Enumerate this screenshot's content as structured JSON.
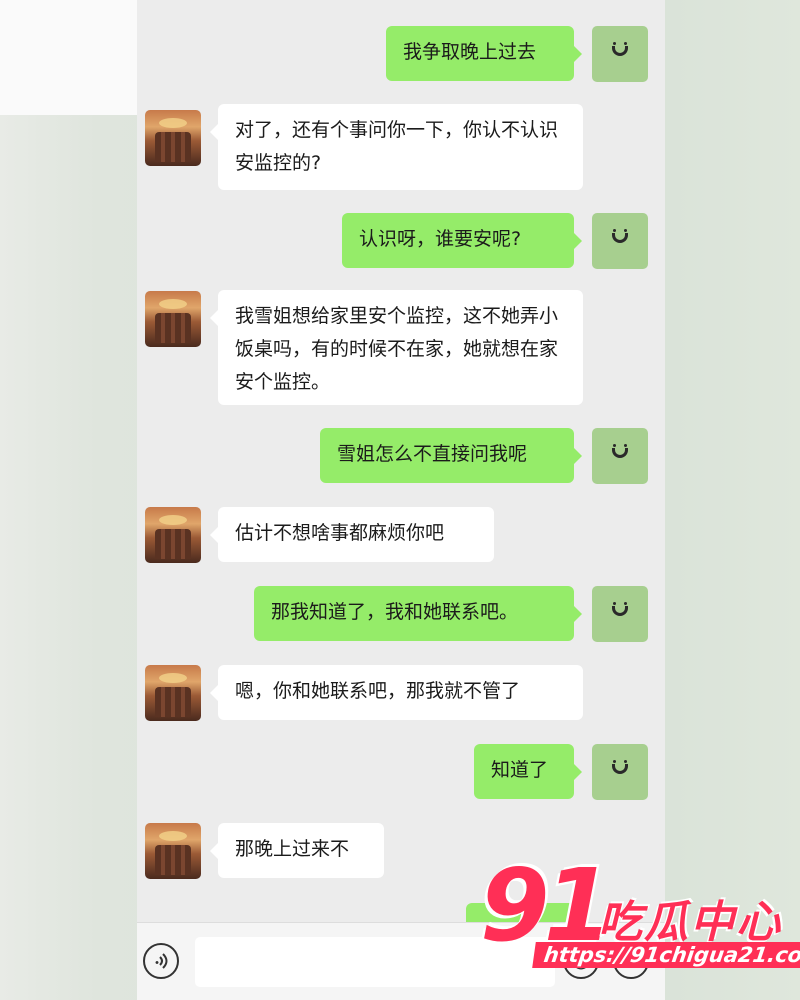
{
  "messages": [
    {
      "side": "out",
      "text": "我争取晚上过去"
    },
    {
      "side": "in",
      "text": "对了，还有个事问你一下，你认不认识安监控的?"
    },
    {
      "side": "out",
      "text": "认识呀，谁要安呢?"
    },
    {
      "side": "in",
      "text": "我雪姐想给家里安个监控，这不她弄小饭桌吗，有的时候不在家，她就想在家安个监控。"
    },
    {
      "side": "out",
      "text": "雪姐怎么不直接问我呢"
    },
    {
      "side": "in",
      "text": "估计不想啥事都麻烦你吧"
    },
    {
      "side": "out",
      "text": "那我知道了，我和她联系吧。"
    },
    {
      "side": "in",
      "text": "嗯，你和她联系吧，那我就不管了"
    },
    {
      "side": "out",
      "text": "知道了"
    },
    {
      "side": "in",
      "text": "那晚上过来不"
    }
  ],
  "input_bar": {
    "voice_icon": "voice-icon",
    "emoji_icon": "emoji-icon",
    "plus_icon": "plus-icon"
  },
  "watermark": {
    "logo_number": "91",
    "logo_text": "吃瓜中心",
    "url": "https://91chigua21.com"
  },
  "colors": {
    "outgoing_bubble": "#95ec69",
    "incoming_bubble": "#ffffff",
    "chat_background": "#ececec",
    "watermark": "#ff2f56"
  }
}
